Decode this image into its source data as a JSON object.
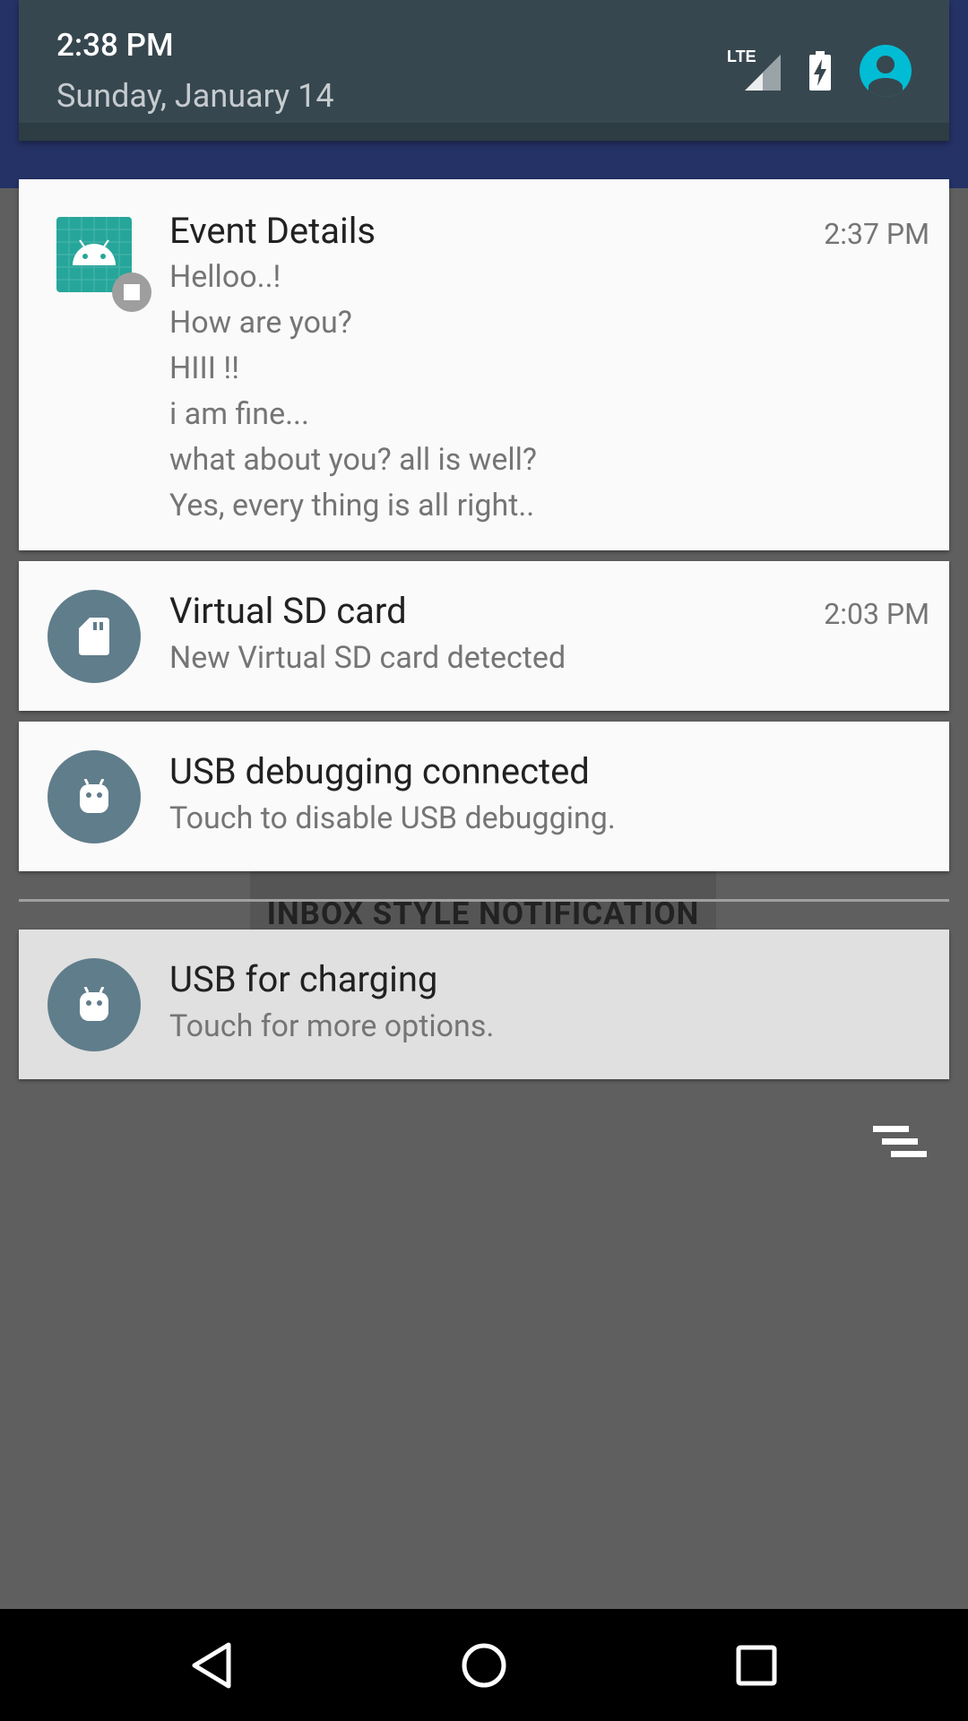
{
  "background_app": {
    "button_label": "INBOX STYLE NOTIFICATION"
  },
  "status_header": {
    "time": "2:38 PM",
    "date": "Sunday, January 14",
    "signal_label": "LTE",
    "icons": [
      "lte-signal-icon",
      "battery-charging-icon",
      "user-avatar-icon"
    ]
  },
  "notifications": [
    {
      "title": "Event Details",
      "time": "2:37 PM",
      "icon": "android-app-icon",
      "lines": [
        "Helloo..!",
        "How are you?",
        "HIII !!",
        "i am fine...",
        "what about you? all is well?",
        "Yes, every thing is all right.."
      ]
    },
    {
      "title": "Virtual SD card",
      "time": "2:03 PM",
      "icon": "sd-card-icon",
      "text": "New Virtual SD card detected"
    },
    {
      "title": "USB debugging connected",
      "icon": "android-debug-icon",
      "text": "Touch to disable USB debugging."
    },
    {
      "title": "USB for charging",
      "icon": "android-usb-icon",
      "text": "Touch for more options."
    }
  ],
  "actions": {
    "clear_all_icon": "clear-all-icon"
  },
  "navigation": {
    "buttons": [
      "back-icon",
      "home-icon",
      "recents-icon"
    ]
  },
  "colors": {
    "header_bg": "#37474f",
    "avatar": "#00bcd4",
    "app_icon": "#26a69a",
    "circle_icon": "#607d8b"
  }
}
